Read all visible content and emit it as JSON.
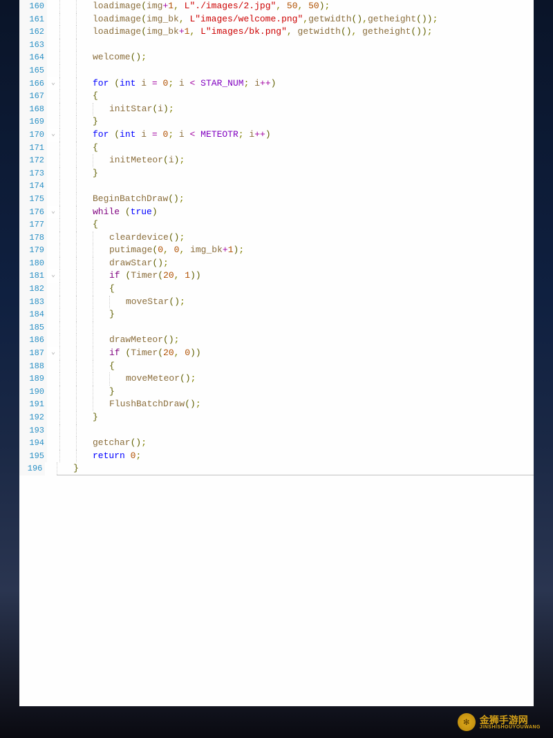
{
  "watermark": {
    "title": "金狮手游网",
    "subtitle": "JINSHISHOUYOUWANG"
  },
  "code_lines": [
    {
      "n": 160,
      "fold": "",
      "indent": 2,
      "tokens": [
        [
          "id",
          "loadimage"
        ],
        [
          "paren",
          "("
        ],
        [
          "id",
          "img"
        ],
        [
          "op",
          "+"
        ],
        [
          "num",
          "1"
        ],
        [
          "punct",
          ", "
        ],
        [
          "str",
          "L\"./images/2.jpg\""
        ],
        [
          "punct",
          ", "
        ],
        [
          "num",
          "50"
        ],
        [
          "punct",
          ", "
        ],
        [
          "num",
          "50"
        ],
        [
          "paren",
          ")"
        ],
        [
          "punct",
          ";"
        ]
      ]
    },
    {
      "n": 161,
      "fold": "",
      "indent": 2,
      "tokens": [
        [
          "id",
          "loadimage"
        ],
        [
          "paren",
          "("
        ],
        [
          "id",
          "img_bk"
        ],
        [
          "punct",
          ", "
        ],
        [
          "str",
          "L\"images/welcome.png\""
        ],
        [
          "punct",
          ","
        ],
        [
          "id",
          "getwidth"
        ],
        [
          "paren",
          "()"
        ],
        [
          "punct",
          ","
        ],
        [
          "id",
          "getheight"
        ],
        [
          "paren",
          "()"
        ],
        [
          "paren",
          ")"
        ],
        [
          "punct",
          ";"
        ]
      ]
    },
    {
      "n": 162,
      "fold": "",
      "indent": 2,
      "tokens": [
        [
          "id",
          "loadimage"
        ],
        [
          "paren",
          "("
        ],
        [
          "id",
          "img_bk"
        ],
        [
          "op",
          "+"
        ],
        [
          "num",
          "1"
        ],
        [
          "punct",
          ", "
        ],
        [
          "str",
          "L\"images/bk.png\""
        ],
        [
          "punct",
          ", "
        ],
        [
          "id",
          "getwidth"
        ],
        [
          "paren",
          "()"
        ],
        [
          "punct",
          ", "
        ],
        [
          "id",
          "getheight"
        ],
        [
          "paren",
          "()"
        ],
        [
          "paren",
          ")"
        ],
        [
          "punct",
          ";"
        ]
      ]
    },
    {
      "n": 163,
      "fold": "",
      "indent": 2,
      "tokens": []
    },
    {
      "n": 164,
      "fold": "",
      "indent": 2,
      "tokens": [
        [
          "id",
          "welcome"
        ],
        [
          "paren",
          "()"
        ],
        [
          "punct",
          ";"
        ]
      ]
    },
    {
      "n": 165,
      "fold": "",
      "indent": 2,
      "tokens": []
    },
    {
      "n": 166,
      "fold": "⌄",
      "indent": 2,
      "tokens": [
        [
          "kw",
          "for"
        ],
        [
          "text",
          " "
        ],
        [
          "paren",
          "("
        ],
        [
          "kw",
          "int"
        ],
        [
          "text",
          " "
        ],
        [
          "id",
          "i"
        ],
        [
          "text",
          " "
        ],
        [
          "op",
          "="
        ],
        [
          "text",
          " "
        ],
        [
          "num",
          "0"
        ],
        [
          "punct",
          "; "
        ],
        [
          "id",
          "i"
        ],
        [
          "text",
          " "
        ],
        [
          "op",
          "<"
        ],
        [
          "text",
          " "
        ],
        [
          "const",
          "STAR_NUM"
        ],
        [
          "punct",
          "; "
        ],
        [
          "id",
          "i"
        ],
        [
          "op",
          "++"
        ],
        [
          "paren",
          ")"
        ]
      ]
    },
    {
      "n": 167,
      "fold": "",
      "indent": 2,
      "tokens": [
        [
          "paren",
          "{"
        ]
      ]
    },
    {
      "n": 168,
      "fold": "",
      "indent": 3,
      "tokens": [
        [
          "id",
          "initStar"
        ],
        [
          "paren",
          "("
        ],
        [
          "id",
          "i"
        ],
        [
          "paren",
          ")"
        ],
        [
          "punct",
          ";"
        ]
      ]
    },
    {
      "n": 169,
      "fold": "",
      "indent": 2,
      "tokens": [
        [
          "paren",
          "}"
        ]
      ]
    },
    {
      "n": 170,
      "fold": "⌄",
      "indent": 2,
      "tokens": [
        [
          "kw",
          "for"
        ],
        [
          "text",
          " "
        ],
        [
          "paren",
          "("
        ],
        [
          "kw",
          "int"
        ],
        [
          "text",
          " "
        ],
        [
          "id",
          "i"
        ],
        [
          "text",
          " "
        ],
        [
          "op",
          "="
        ],
        [
          "text",
          " "
        ],
        [
          "num",
          "0"
        ],
        [
          "punct",
          "; "
        ],
        [
          "id",
          "i"
        ],
        [
          "text",
          " "
        ],
        [
          "op",
          "<"
        ],
        [
          "text",
          " "
        ],
        [
          "const",
          "METEOTR"
        ],
        [
          "punct",
          "; "
        ],
        [
          "id",
          "i"
        ],
        [
          "op",
          "++"
        ],
        [
          "paren",
          ")"
        ]
      ]
    },
    {
      "n": 171,
      "fold": "",
      "indent": 2,
      "tokens": [
        [
          "paren",
          "{"
        ]
      ]
    },
    {
      "n": 172,
      "fold": "",
      "indent": 3,
      "tokens": [
        [
          "id",
          "initMeteor"
        ],
        [
          "paren",
          "("
        ],
        [
          "id",
          "i"
        ],
        [
          "paren",
          ")"
        ],
        [
          "punct",
          ";"
        ]
      ]
    },
    {
      "n": 173,
      "fold": "",
      "indent": 2,
      "tokens": [
        [
          "paren",
          "}"
        ]
      ]
    },
    {
      "n": 174,
      "fold": "",
      "indent": 2,
      "tokens": []
    },
    {
      "n": 175,
      "fold": "",
      "indent": 2,
      "tokens": [
        [
          "id",
          "BeginBatchDraw"
        ],
        [
          "paren",
          "()"
        ],
        [
          "punct",
          ";"
        ]
      ]
    },
    {
      "n": 176,
      "fold": "⌄",
      "indent": 2,
      "tokens": [
        [
          "kw2",
          "while"
        ],
        [
          "text",
          " "
        ],
        [
          "paren",
          "("
        ],
        [
          "bool",
          "true"
        ],
        [
          "paren",
          ")"
        ]
      ]
    },
    {
      "n": 177,
      "fold": "",
      "indent": 2,
      "tokens": [
        [
          "paren",
          "{"
        ]
      ]
    },
    {
      "n": 178,
      "fold": "",
      "indent": 3,
      "tokens": [
        [
          "id",
          "cleardevice"
        ],
        [
          "paren",
          "()"
        ],
        [
          "punct",
          ";"
        ]
      ]
    },
    {
      "n": 179,
      "fold": "",
      "indent": 3,
      "tokens": [
        [
          "id",
          "putimage"
        ],
        [
          "paren",
          "("
        ],
        [
          "num",
          "0"
        ],
        [
          "punct",
          ", "
        ],
        [
          "num",
          "0"
        ],
        [
          "punct",
          ", "
        ],
        [
          "id",
          "img_bk"
        ],
        [
          "op",
          "+"
        ],
        [
          "num",
          "1"
        ],
        [
          "paren",
          ")"
        ],
        [
          "punct",
          ";"
        ]
      ]
    },
    {
      "n": 180,
      "fold": "",
      "indent": 3,
      "tokens": [
        [
          "id",
          "drawStar"
        ],
        [
          "paren",
          "()"
        ],
        [
          "punct",
          ";"
        ]
      ]
    },
    {
      "n": 181,
      "fold": "⌄",
      "indent": 3,
      "tokens": [
        [
          "kw2",
          "if"
        ],
        [
          "text",
          " "
        ],
        [
          "paren",
          "("
        ],
        [
          "id",
          "Timer"
        ],
        [
          "paren",
          "("
        ],
        [
          "num",
          "20"
        ],
        [
          "punct",
          ", "
        ],
        [
          "num",
          "1"
        ],
        [
          "paren",
          "))"
        ]
      ]
    },
    {
      "n": 182,
      "fold": "",
      "indent": 3,
      "tokens": [
        [
          "paren",
          "{"
        ]
      ]
    },
    {
      "n": 183,
      "fold": "",
      "indent": 4,
      "tokens": [
        [
          "id",
          "moveStar"
        ],
        [
          "paren",
          "()"
        ],
        [
          "punct",
          ";"
        ]
      ]
    },
    {
      "n": 184,
      "fold": "",
      "indent": 3,
      "tokens": [
        [
          "paren",
          "}"
        ]
      ]
    },
    {
      "n": 185,
      "fold": "",
      "indent": 3,
      "tokens": []
    },
    {
      "n": 186,
      "fold": "",
      "indent": 3,
      "tokens": [
        [
          "id",
          "drawMeteor"
        ],
        [
          "paren",
          "()"
        ],
        [
          "punct",
          ";"
        ]
      ]
    },
    {
      "n": 187,
      "fold": "⌄",
      "indent": 3,
      "tokens": [
        [
          "kw2",
          "if"
        ],
        [
          "text",
          " "
        ],
        [
          "paren",
          "("
        ],
        [
          "id",
          "Timer"
        ],
        [
          "paren",
          "("
        ],
        [
          "num",
          "20"
        ],
        [
          "punct",
          ", "
        ],
        [
          "num",
          "0"
        ],
        [
          "paren",
          "))"
        ]
      ]
    },
    {
      "n": 188,
      "fold": "",
      "indent": 3,
      "tokens": [
        [
          "paren",
          "{"
        ]
      ]
    },
    {
      "n": 189,
      "fold": "",
      "indent": 4,
      "tokens": [
        [
          "id",
          "moveMeteor"
        ],
        [
          "paren",
          "()"
        ],
        [
          "punct",
          ";"
        ]
      ]
    },
    {
      "n": 190,
      "fold": "",
      "indent": 3,
      "tokens": [
        [
          "paren",
          "}"
        ]
      ]
    },
    {
      "n": 191,
      "fold": "",
      "indent": 3,
      "tokens": [
        [
          "id",
          "FlushBatchDraw"
        ],
        [
          "paren",
          "()"
        ],
        [
          "punct",
          ";"
        ]
      ]
    },
    {
      "n": 192,
      "fold": "",
      "indent": 2,
      "tokens": [
        [
          "paren",
          "}"
        ]
      ]
    },
    {
      "n": 193,
      "fold": "",
      "indent": 2,
      "tokens": []
    },
    {
      "n": 194,
      "fold": "",
      "indent": 2,
      "tokens": [
        [
          "id",
          "getchar"
        ],
        [
          "paren",
          "()"
        ],
        [
          "punct",
          ";"
        ]
      ]
    },
    {
      "n": 195,
      "fold": "",
      "indent": 2,
      "tokens": [
        [
          "kw",
          "return"
        ],
        [
          "text",
          " "
        ],
        [
          "num",
          "0"
        ],
        [
          "punct",
          ";"
        ]
      ]
    },
    {
      "n": 196,
      "fold": "",
      "indent": 1,
      "tokens": [
        [
          "paren",
          "}"
        ]
      ],
      "cursor": true
    }
  ]
}
